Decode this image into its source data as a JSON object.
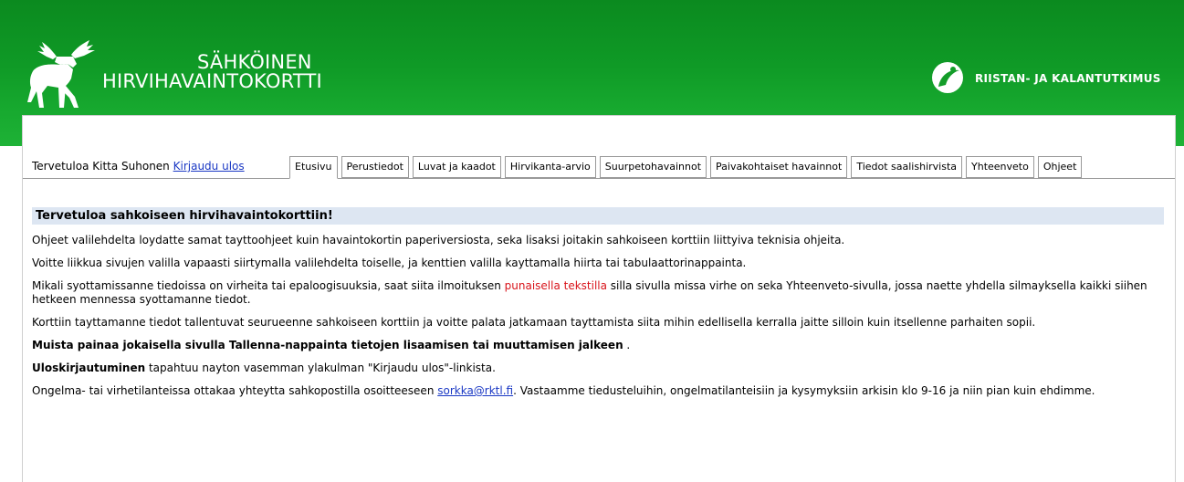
{
  "header": {
    "title_line1": "SÄHKÖINEN",
    "title_line2": "HIRVIHAVAINTOKORTTI",
    "org_name": "RIISTAN- JA KALANTUTKIMUS",
    "brand_color": "#139d29"
  },
  "user": {
    "greeting": "Tervetuloa Kitta Suhonen",
    "logout_label": "Kirjaudu ulos"
  },
  "tabs": [
    {
      "label": "Etusivu",
      "active": true
    },
    {
      "label": "Perustiedot"
    },
    {
      "label": "Luvat ja kaadot"
    },
    {
      "label": "Hirvikanta-arvio"
    },
    {
      "label": "Suurpetohavainnot"
    },
    {
      "label": "Paivakohtaiset havainnot"
    },
    {
      "label": "Tiedot saalishirvista"
    },
    {
      "label": "Yhteenveto"
    },
    {
      "label": "Ohjeet"
    }
  ],
  "content": {
    "heading": "Tervetuloa sahkoiseen hirvihavaintokorttiin!",
    "p1": "Ohjeet valilehdelta loydatte samat tayttoohjeet kuin havaintokortin paperiversiosta, seka lisaksi joitakin sahkoiseen korttiin liittyiva teknisia ohjeita.",
    "p2": "Voitte liikkua sivujen valilla vapaasti siirtymalla valilehdelta toiselle, ja kenttien valilla kayttamalla hiirta tai tabulaattorinappainta.",
    "p3_before": "Mikali syottamissanne tiedoissa on virheita tai epaloogisuuksia, saat siita ilmoituksen ",
    "p3_red": "punaisella tekstilla",
    "p3_after": " silla sivulla missa virhe on seka Yhteenveto-sivulla, jossa naette yhdella silmayksella kaikki siihen hetkeen mennessa syottamanne tiedot.",
    "p4": "Korttiin tayttamanne tiedot tallentuvat seurueenne sahkoiseen korttiin ja voitte palata jatkamaan tayttamista siita mihin edellisella kerralla jaitte silloin kuin itsellenne parhaiten sopii.",
    "p5_bold": "Muista painaa jokaisella sivulla Tallenna-nappainta tietojen lisaamisen tai muuttamisen jalkeen",
    "p5_after": " .",
    "p6_bold": "Uloskirjautuminen",
    "p6_after": " tapahtuu nayton vasemman ylakulman \"Kirjaudu ulos\"-linkista.",
    "p7_before": "Ongelma- tai virhetilanteissa ottakaa yhteytta sahkopostilla osoitteeseen ",
    "p7_link": "sorkka@rktl.fi",
    "p7_after": ". Vastaamme tiedusteluihin, ongelmatilanteisiin ja kysymyksiin arkisin klo 9-16 ja niin pian kuin ehdimme."
  }
}
